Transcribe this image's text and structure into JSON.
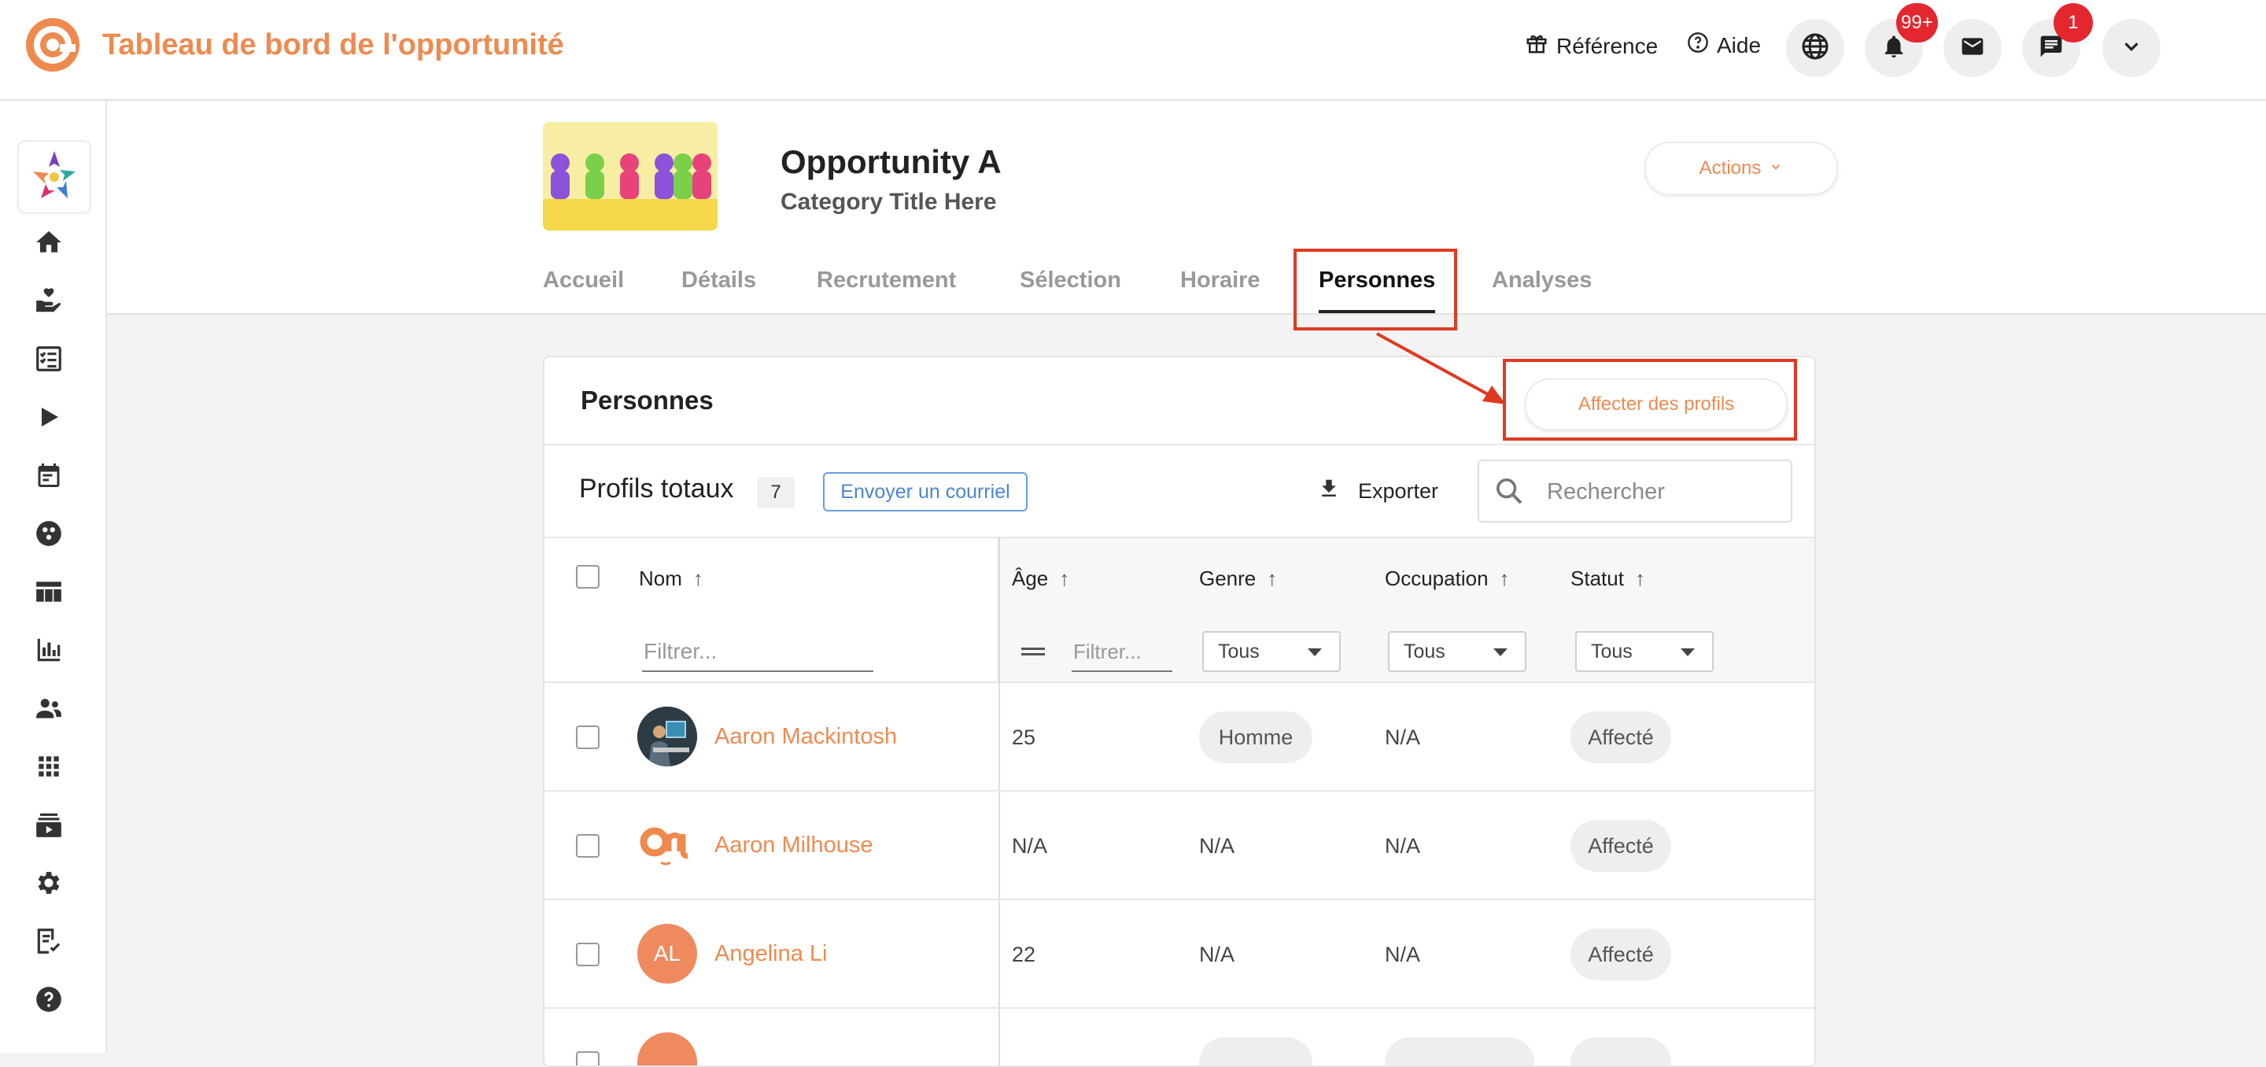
{
  "app": {
    "title": "Tableau de bord de l'opportunité",
    "reference_label": "Référence",
    "help_label": "Aide",
    "notifications_badge": "99+",
    "chat_badge": "1"
  },
  "opportunity": {
    "title": "Opportunity A",
    "category": "Category Title Here",
    "actions_label": "Actions"
  },
  "tabs": [
    {
      "label": "Accueil"
    },
    {
      "label": "Détails"
    },
    {
      "label": "Recrutement"
    },
    {
      "label": "Sélection"
    },
    {
      "label": "Horaire"
    },
    {
      "label": "Personnes"
    },
    {
      "label": "Analyses"
    }
  ],
  "people_card": {
    "title": "Personnes",
    "assign_label": "Affecter des profils",
    "total_label": "Profils totaux",
    "total_count": "7",
    "email_label": "Envoyer un courriel",
    "export_label": "Exporter",
    "search_placeholder": "Rechercher"
  },
  "table": {
    "columns": {
      "name": "Nom",
      "age": "Âge",
      "gender": "Genre",
      "occupation": "Occupation",
      "status": "Statut"
    },
    "filter_placeholder": "Filtrer...",
    "select_all": "Tous",
    "rows": [
      {
        "name": "Aaron Mackintosh",
        "age": "25",
        "gender": "Homme",
        "occupation": "N/A",
        "status": "Affecté"
      },
      {
        "name": "Aaron Milhouse",
        "age": "N/A",
        "gender": "N/A",
        "occupation": "N/A",
        "status": "Affecté"
      },
      {
        "name": "Angelina Li",
        "initials": "AL",
        "age": "22",
        "gender": "N/A",
        "occupation": "N/A",
        "status": "Affecté"
      }
    ]
  },
  "colors": {
    "brand": "#ef8a4f",
    "badge": "#e4262e",
    "highlight": "#e03a22",
    "email_button": "#4a86d0"
  },
  "icons": [
    "gift-icon",
    "help-circle-icon",
    "globe-icon",
    "bell-icon",
    "mail-icon",
    "chat-icon",
    "chevron-down-icon",
    "home-icon",
    "hand-heart-icon",
    "checklist-icon",
    "play-icon",
    "calendar-icon",
    "groups-icon",
    "board-icon",
    "bar-chart-icon",
    "people-icon",
    "apps-grid-icon",
    "subscriptions-icon",
    "settings-icon",
    "assignment-check-icon",
    "help-icon",
    "download-icon",
    "search-icon",
    "sort-arrow-up-icon",
    "drag-handle-icon"
  ]
}
